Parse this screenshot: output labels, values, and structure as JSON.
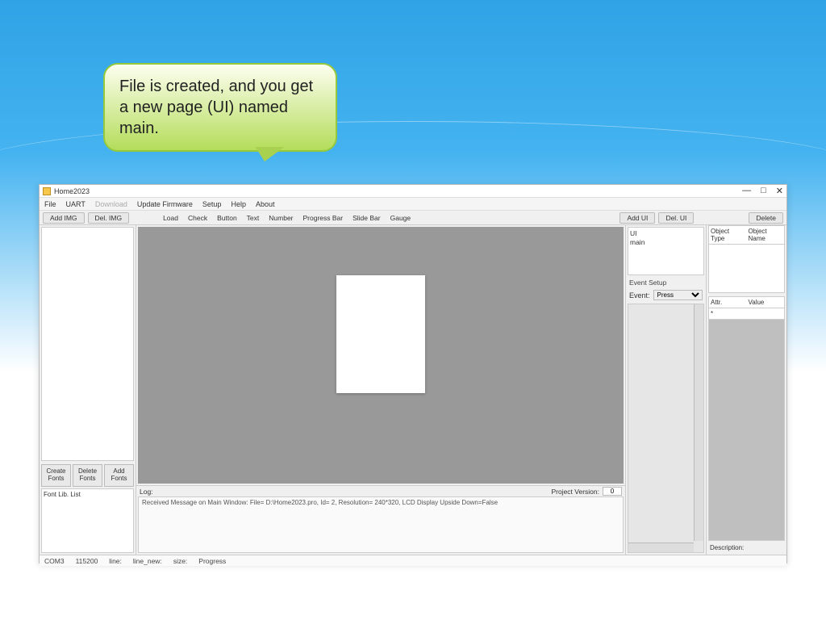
{
  "callout_text": "File is created, and you get a new page (UI) named main.",
  "app": {
    "title": "Home2023",
    "menu": [
      "File",
      "UART",
      "Download",
      "Update Firmware",
      "Setup",
      "Help",
      "About"
    ],
    "menu_dimmed": [
      2
    ],
    "left_toolbar": {
      "add_img": "Add IMG",
      "del_img": "Del. IMG"
    },
    "tool_labels": [
      "Load",
      "Check",
      "Button",
      "Text",
      "Number",
      "Progress Bar",
      "Slide Bar",
      "Gauge"
    ],
    "right_toolbar": {
      "add_ui": "Add UI",
      "del_ui": "Del. UI",
      "delete": "Delete"
    },
    "ui_list": {
      "header": "UI",
      "items": [
        "main"
      ]
    },
    "event": {
      "section": "Event Setup",
      "label": "Event:",
      "selected": "Press"
    },
    "obj_headers": {
      "type": "Object Type",
      "name": "Object Name"
    },
    "attr_headers": {
      "attr": "Attr.",
      "value": "Value"
    },
    "attr_first": "*",
    "desc_label": "Description:",
    "fonts": {
      "create": "Create Fonts",
      "delete": "Delete Fonts",
      "add": "Add Fonts"
    },
    "fontlist_label": "Font Lib. List",
    "log_label": "Log:",
    "proj_ver_label": "Project Version:",
    "proj_ver_value": "0",
    "log_text": "Received Message on Main Window: File= D:\\Home2023.pro, Id= 2, Resolution= 240*320, LCD Display Upside Down=False",
    "status": {
      "com": "COM3",
      "baud": "115200",
      "line": "line:",
      "line_new": "line_new:",
      "size": "size:",
      "progress": "Progress"
    }
  }
}
